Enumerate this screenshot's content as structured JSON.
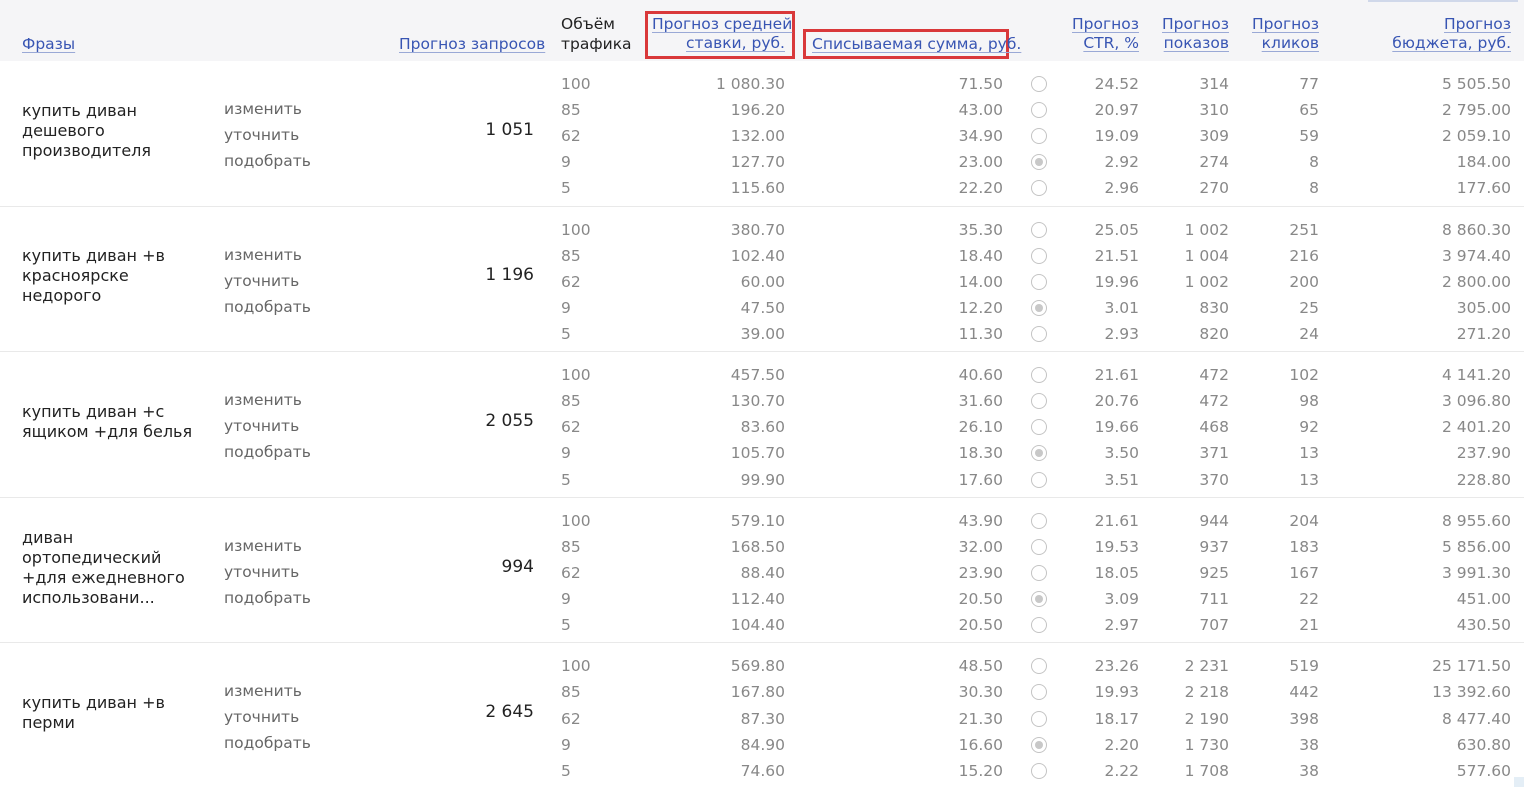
{
  "columns": {
    "phrases": "Фразы",
    "requests_forecast": "Прогноз запросов",
    "traffic_volume": [
      "Объём",
      "трафика"
    ],
    "avg_bid": [
      "Прогноз средней",
      "ставки, руб."
    ],
    "charged_amount": "Списываемая сумма, руб.",
    "ctr": [
      "Прогноз",
      "CTR, %"
    ],
    "impressions": [
      "Прогноз",
      "показов"
    ],
    "clicks": [
      "Прогноз",
      "кликов"
    ],
    "budget": [
      "Прогноз",
      "бюджета, руб."
    ]
  },
  "actions": [
    "изменить",
    "уточнить",
    "подобрать"
  ],
  "groups": [
    {
      "phrase": [
        "купить диван",
        "дешевого",
        "производителя"
      ],
      "requests": "1 051",
      "selected": 3,
      "rows": [
        {
          "vol": "100",
          "bid": "1 080.30",
          "charge": "71.50",
          "ctr": "24.52",
          "imp": "314",
          "clk": "77",
          "bud": "5 505.50"
        },
        {
          "vol": "85",
          "bid": "196.20",
          "charge": "43.00",
          "ctr": "20.97",
          "imp": "310",
          "clk": "65",
          "bud": "2 795.00"
        },
        {
          "vol": "62",
          "bid": "132.00",
          "charge": "34.90",
          "ctr": "19.09",
          "imp": "309",
          "clk": "59",
          "bud": "2 059.10"
        },
        {
          "vol": "9",
          "bid": "127.70",
          "charge": "23.00",
          "ctr": "2.92",
          "imp": "274",
          "clk": "8",
          "bud": "184.00"
        },
        {
          "vol": "5",
          "bid": "115.60",
          "charge": "22.20",
          "ctr": "2.96",
          "imp": "270",
          "clk": "8",
          "bud": "177.60"
        }
      ]
    },
    {
      "phrase": [
        "купить диван +в",
        "красноярске",
        "недорого"
      ],
      "requests": "1 196",
      "selected": 3,
      "rows": [
        {
          "vol": "100",
          "bid": "380.70",
          "charge": "35.30",
          "ctr": "25.05",
          "imp": "1 002",
          "clk": "251",
          "bud": "8 860.30"
        },
        {
          "vol": "85",
          "bid": "102.40",
          "charge": "18.40",
          "ctr": "21.51",
          "imp": "1 004",
          "clk": "216",
          "bud": "3 974.40"
        },
        {
          "vol": "62",
          "bid": "60.00",
          "charge": "14.00",
          "ctr": "19.96",
          "imp": "1 002",
          "clk": "200",
          "bud": "2 800.00"
        },
        {
          "vol": "9",
          "bid": "47.50",
          "charge": "12.20",
          "ctr": "3.01",
          "imp": "830",
          "clk": "25",
          "bud": "305.00"
        },
        {
          "vol": "5",
          "bid": "39.00",
          "charge": "11.30",
          "ctr": "2.93",
          "imp": "820",
          "clk": "24",
          "bud": "271.20"
        }
      ]
    },
    {
      "phrase": [
        "купить диван +с",
        "ящиком +для белья"
      ],
      "requests": "2 055",
      "selected": 3,
      "rows": [
        {
          "vol": "100",
          "bid": "457.50",
          "charge": "40.60",
          "ctr": "21.61",
          "imp": "472",
          "clk": "102",
          "bud": "4 141.20"
        },
        {
          "vol": "85",
          "bid": "130.70",
          "charge": "31.60",
          "ctr": "20.76",
          "imp": "472",
          "clk": "98",
          "bud": "3 096.80"
        },
        {
          "vol": "62",
          "bid": "83.60",
          "charge": "26.10",
          "ctr": "19.66",
          "imp": "468",
          "clk": "92",
          "bud": "2 401.20"
        },
        {
          "vol": "9",
          "bid": "105.70",
          "charge": "18.30",
          "ctr": "3.50",
          "imp": "371",
          "clk": "13",
          "bud": "237.90"
        },
        {
          "vol": "5",
          "bid": "99.90",
          "charge": "17.60",
          "ctr": "3.51",
          "imp": "370",
          "clk": "13",
          "bud": "228.80"
        }
      ]
    },
    {
      "phrase": [
        "диван",
        "ортопедический",
        "+для ежедневного",
        "использовани..."
      ],
      "requests": "994",
      "selected": 3,
      "rows": [
        {
          "vol": "100",
          "bid": "579.10",
          "charge": "43.90",
          "ctr": "21.61",
          "imp": "944",
          "clk": "204",
          "bud": "8 955.60"
        },
        {
          "vol": "85",
          "bid": "168.50",
          "charge": "32.00",
          "ctr": "19.53",
          "imp": "937",
          "clk": "183",
          "bud": "5 856.00"
        },
        {
          "vol": "62",
          "bid": "88.40",
          "charge": "23.90",
          "ctr": "18.05",
          "imp": "925",
          "clk": "167",
          "bud": "3 991.30"
        },
        {
          "vol": "9",
          "bid": "112.40",
          "charge": "20.50",
          "ctr": "3.09",
          "imp": "711",
          "clk": "22",
          "bud": "451.00"
        },
        {
          "vol": "5",
          "bid": "104.40",
          "charge": "20.50",
          "ctr": "2.97",
          "imp": "707",
          "clk": "21",
          "bud": "430.50"
        }
      ]
    },
    {
      "phrase": [
        "купить диван +в",
        "перми"
      ],
      "requests": "2 645",
      "selected": 3,
      "rows": [
        {
          "vol": "100",
          "bid": "569.80",
          "charge": "48.50",
          "ctr": "23.26",
          "imp": "2 231",
          "clk": "519",
          "bud": "25 171.50"
        },
        {
          "vol": "85",
          "bid": "167.80",
          "charge": "30.30",
          "ctr": "19.93",
          "imp": "2 218",
          "clk": "442",
          "bud": "13 392.60"
        },
        {
          "vol": "62",
          "bid": "87.30",
          "charge": "21.30",
          "ctr": "18.17",
          "imp": "2 190",
          "clk": "398",
          "bud": "8 477.40"
        },
        {
          "vol": "9",
          "bid": "84.90",
          "charge": "16.60",
          "ctr": "2.20",
          "imp": "1 730",
          "clk": "38",
          "bud": "630.80"
        },
        {
          "vol": "5",
          "bid": "74.60",
          "charge": "15.20",
          "ctr": "2.22",
          "imp": "1 708",
          "clk": "38",
          "bud": "577.60"
        }
      ]
    }
  ]
}
